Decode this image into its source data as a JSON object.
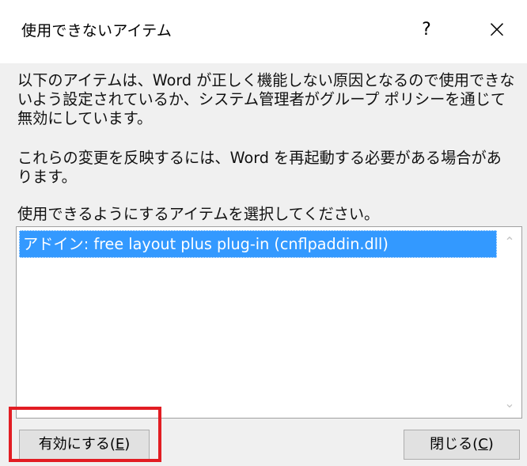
{
  "window": {
    "title": "使用できないアイテム",
    "help_label": "?",
    "close_label": "×"
  },
  "content": {
    "description_1": "以下のアイテムは、Word が正しく機能しない原因となるので使用できないよう設定されているか、システム管理者がグループ ポリシーを通じて無効にしています。",
    "description_2": "これらの変更を反映するには、Word を再起動する必要がある場合があります。",
    "instruction": "使用できるようにするアイテムを選択してください。"
  },
  "list": {
    "items": [
      {
        "label": "アドイン: free layout plus plug-in (cnflpaddin.dll)",
        "selected": true
      }
    ],
    "scroll_up_label": "⌃",
    "scroll_down_label": "⌄"
  },
  "buttons": {
    "enable_prefix": "有効にする(",
    "enable_hotkey": "E",
    "enable_suffix": ")",
    "close_prefix": "閉じる(",
    "close_hotkey": "C",
    "close_suffix": ")"
  },
  "annotation": {
    "highlight_color": "#e21d23"
  },
  "colors": {
    "selection": "#3399ff",
    "dialog_background": "#f0f0f0",
    "button_background": "#e1e1e1"
  }
}
